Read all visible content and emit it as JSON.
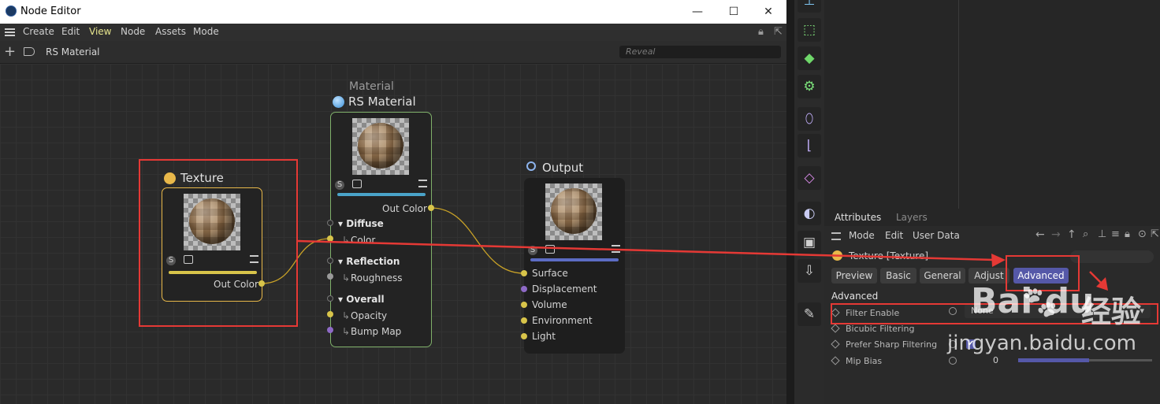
{
  "window": {
    "title": "Node Editor",
    "minimize": "—",
    "maximize": "☐",
    "close": "✕"
  },
  "menu": {
    "items": [
      "Create",
      "Edit",
      "View",
      "Node",
      "Assets",
      "Mode"
    ],
    "active": "View"
  },
  "path": {
    "material_name": "RS Material",
    "reveal_placeholder": "Reveal"
  },
  "nodes": {
    "texture": {
      "title": "Texture",
      "output": "Out Color",
      "accent": "#e8b84a"
    },
    "material": {
      "category": "Material",
      "title": "RS Material",
      "output": "Out Color",
      "sections": [
        {
          "name": "Diffuse",
          "ports": [
            "Color"
          ]
        },
        {
          "name": "Reflection",
          "ports": [
            "Roughness"
          ]
        },
        {
          "name": "Overall",
          "ports": [
            "Opacity",
            "Bump Map"
          ]
        }
      ],
      "accent": "#7fb06a"
    },
    "output": {
      "title": "Output",
      "inputs": [
        "Surface",
        "Displacement",
        "Volume",
        "Environment",
        "Light"
      ]
    },
    "badge_s": "S"
  },
  "attributes": {
    "tabs": [
      "Attributes",
      "Layers"
    ],
    "menu": [
      "Mode",
      "Edit",
      "User Data"
    ],
    "object_label": "Texture [Texture]",
    "buttons": [
      "Preview",
      "Basic",
      "General",
      "Adjust",
      "Advanced"
    ],
    "selected_button": "Advanced",
    "section": "Advanced",
    "params": [
      {
        "label": "Filter Enable",
        "value": "None"
      },
      {
        "label": "Bicubic Filtering",
        "value": ""
      },
      {
        "label": "Prefer Sharp Filtering",
        "value": "✔"
      },
      {
        "label": "Mip Bias",
        "value": "0"
      }
    ]
  },
  "watermark": {
    "brand": "Bai du",
    "cn": "经验",
    "url": "jingyan.baidu.com"
  },
  "colors": {
    "annotation_red": "#e53935",
    "selected_button": "#5558a8",
    "wire": "#c9a227",
    "port_yellow": "#d8c44a",
    "port_purple": "#8e6ac6",
    "port_gray": "#9a9a9a"
  }
}
